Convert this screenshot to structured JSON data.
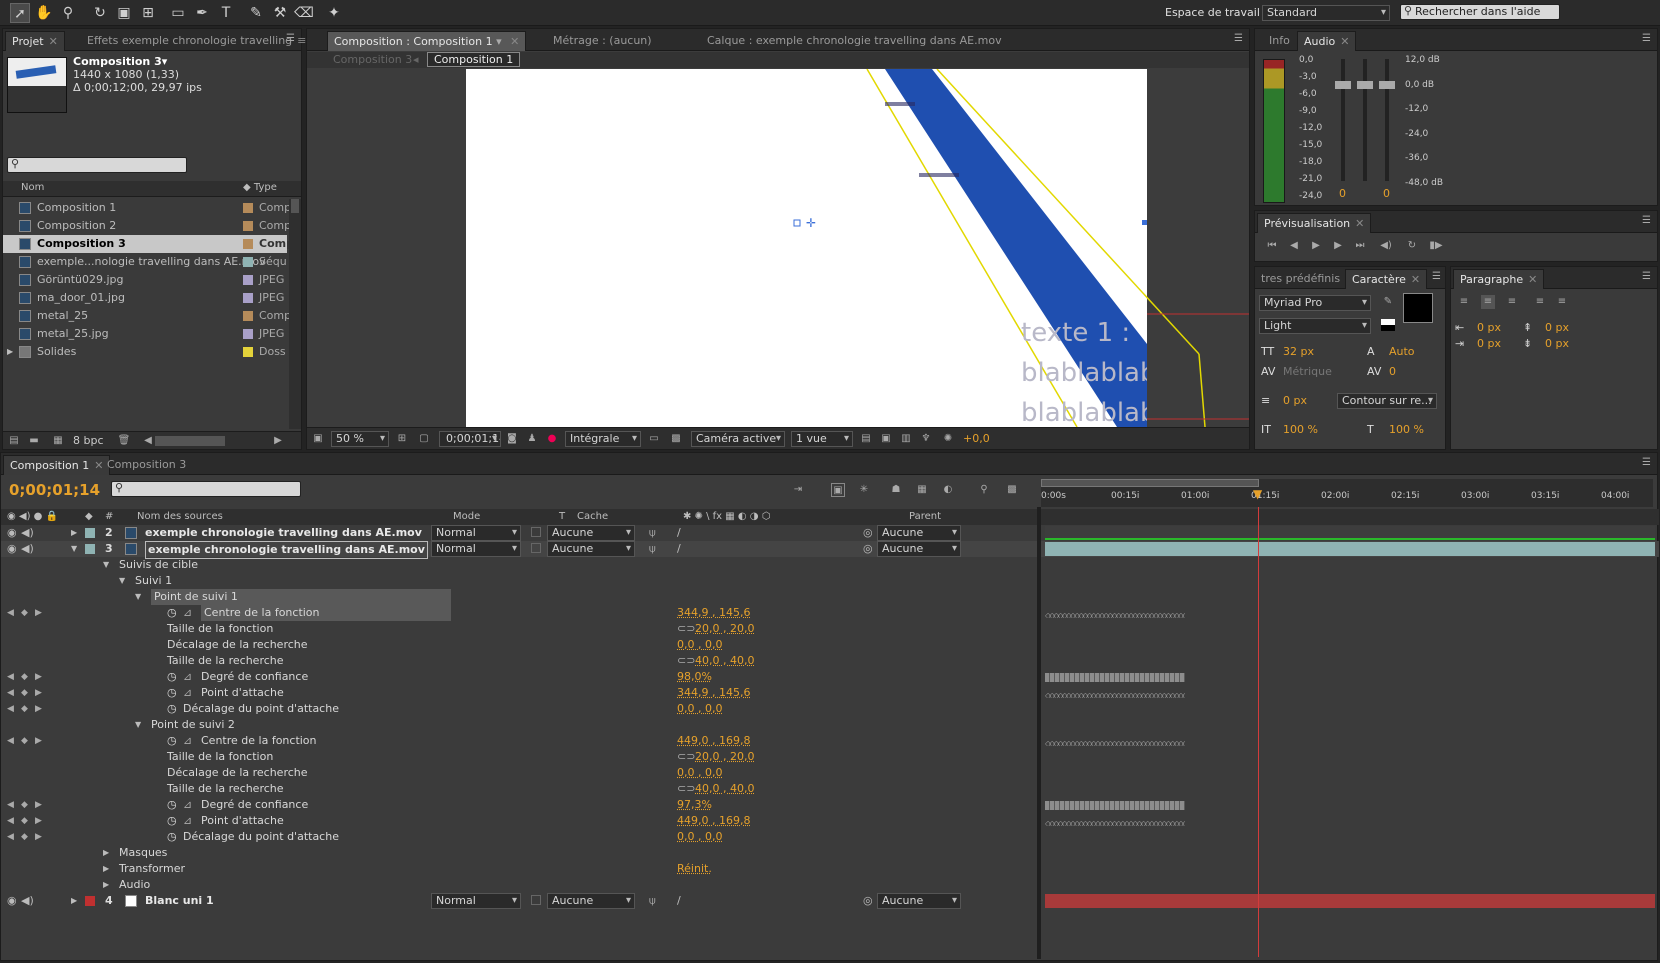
{
  "workspace": {
    "label": "Espace de travail :",
    "value": "Standard",
    "search_placeholder": "Rechercher dans l'aide"
  },
  "project": {
    "tabs": [
      "Projet",
      "Effets exemple chronologie travelling"
    ],
    "selected_name": "Composition 3▾",
    "selected_info1": "1440 x 1080 (1,33)",
    "selected_info2": "Δ 0;00;12;00, 29,97 ips",
    "col_name": "Nom",
    "col_type": "Type",
    "items": [
      {
        "name": "Composition 1",
        "type": "Comp",
        "swatch": "#b58b5a"
      },
      {
        "name": "Composition 2",
        "type": "Comp",
        "swatch": "#b58b5a"
      },
      {
        "name": "Composition 3",
        "type": "Comp",
        "swatch": "#b58b5a"
      },
      {
        "name": "exemple...nologie travelling dans AE.mov",
        "type": "Séqu",
        "swatch": "#8fb3b3"
      },
      {
        "name": "Görüntü029.jpg",
        "type": "JPEG",
        "swatch": "#a9a0c8"
      },
      {
        "name": "ma_door_01.jpg",
        "type": "JPEG",
        "swatch": "#a9a0c8"
      },
      {
        "name": "metal_25",
        "type": "Comp",
        "swatch": "#b58b5a"
      },
      {
        "name": "metal_25.jpg",
        "type": "JPEG",
        "swatch": "#a9a0c8"
      },
      {
        "name": "Solides",
        "type": "Doss",
        "swatch": "#e3d23a"
      }
    ],
    "bpc": "8 bpc"
  },
  "viewer": {
    "tabs": [
      "Composition : Composition 1",
      "Métrage : (aucun)",
      "Calque : exemple chronologie travelling dans AE.mov"
    ],
    "crumbs": [
      "Composition 3",
      "Composition 1"
    ],
    "canvas_text": [
      "texte 1 :",
      "blablablab",
      "blablablab"
    ],
    "zoom": "50 %",
    "timecode": "0;00;01;14",
    "resolution": "Intégrale",
    "camera": "Caméra active",
    "views": "1 vue",
    "exposure": "+0,0"
  },
  "audio_panel": {
    "tabs": [
      "Info",
      "Audio"
    ],
    "left_scale": [
      "0,0",
      "-3,0",
      "-6,0",
      "-9,0",
      "-12,0",
      "-15,0",
      "-18,0",
      "-21,0",
      "-24,0"
    ],
    "right_scale": [
      "12,0 dB",
      "0,0 dB",
      "-12,0",
      "-24,0",
      "-36,0",
      "-48,0 dB"
    ],
    "slider_values": [
      "0",
      "0"
    ]
  },
  "preview": {
    "tab": "Prévisualisation"
  },
  "character": {
    "tabs": [
      "tres prédéfinis",
      "Caractère"
    ],
    "font": "Myriad Pro",
    "style": "Light",
    "size": "32 px",
    "leading": "Auto",
    "kerning": "Métrique",
    "tracking": "0",
    "stroke": "0 px",
    "stroke_mode": "Contour sur re...",
    "vscale": "100 %",
    "hscale": "100 %"
  },
  "paragraph": {
    "tab": "Paragraphe",
    "values": [
      "0 px",
      "0 px",
      "0 px",
      "0 px"
    ]
  },
  "timeline": {
    "tabs": [
      "Composition 1",
      "Composition 3"
    ],
    "timecode": "0;00;01;14",
    "headers": {
      "num": "#",
      "name": "Nom des sources",
      "mode": "Mode",
      "t": "T",
      "cache": "Cache",
      "parent": "Parent"
    },
    "ruler": [
      "0:00s",
      "00:15i",
      "01:00i",
      "01:15i",
      "02:00i",
      "02:15i",
      "03:00i",
      "03:15i",
      "04:00i"
    ],
    "layers": [
      {
        "num": "2",
        "name": "exemple chronologie travelling dans AE.mov",
        "mode": "Normal",
        "cache": "Aucune",
        "parent": "Aucune"
      },
      {
        "num": "3",
        "name": "exemple chronologie travelling dans AE.mov",
        "mode": "Normal",
        "cache": "Aucune",
        "parent": "Aucune"
      },
      {
        "num": "4",
        "name": "Blanc uni 1",
        "mode": "Normal",
        "cache": "Aucune",
        "parent": "Aucune"
      }
    ],
    "props": [
      {
        "label": "Suivis de cible",
        "indent": 1,
        "twirl": "open"
      },
      {
        "label": "Suivi 1",
        "indent": 2,
        "twirl": "open"
      },
      {
        "label": "Point de suivi 1",
        "indent": 3,
        "twirl": "open",
        "hl": true
      },
      {
        "label": "Centre de la fonction",
        "indent": 4,
        "stopwatch": true,
        "graph": true,
        "value": "344,9 , 145,6",
        "hl": true,
        "kf": "kf"
      },
      {
        "label": "Taille de la fonction",
        "indent": 4,
        "link": true,
        "value": "20,0 , 20,0"
      },
      {
        "label": "Décalage de la recherche",
        "indent": 4,
        "value": "0,0 , 0,0"
      },
      {
        "label": "Taille de la recherche",
        "indent": 4,
        "link": true,
        "value": "40,0 , 40,0"
      },
      {
        "label": "Degré de confiance",
        "indent": 4,
        "stopwatch": true,
        "graph": true,
        "value": "98,0%",
        "kf": "bar"
      },
      {
        "label": "Point d'attache",
        "indent": 4,
        "stopwatch": true,
        "graph": true,
        "value": "344,9 , 145,6",
        "kf": "kf"
      },
      {
        "label": "Décalage du point d'attache",
        "indent": 4,
        "stopwatch": true,
        "value": "0,0 , 0,0"
      },
      {
        "label": "Point de suivi 2",
        "indent": 3,
        "twirl": "open"
      },
      {
        "label": "Centre de la fonction",
        "indent": 4,
        "stopwatch": true,
        "graph": true,
        "value": "449,0 , 169,8",
        "kf": "kf"
      },
      {
        "label": "Taille de la fonction",
        "indent": 4,
        "link": true,
        "value": "20,0 , 20,0"
      },
      {
        "label": "Décalage de la recherche",
        "indent": 4,
        "value": "0,0 , 0,0"
      },
      {
        "label": "Taille de la recherche",
        "indent": 4,
        "link": true,
        "value": "40,0 , 40,0"
      },
      {
        "label": "Degré de confiance",
        "indent": 4,
        "stopwatch": true,
        "graph": true,
        "value": "97,3%",
        "kf": "bar"
      },
      {
        "label": "Point d'attache",
        "indent": 4,
        "stopwatch": true,
        "graph": true,
        "value": "449,0 , 169,8",
        "kf": "kf"
      },
      {
        "label": "Décalage du point d'attache",
        "indent": 4,
        "stopwatch": true,
        "value": "0,0 , 0,0"
      },
      {
        "label": "Masques",
        "indent": 1,
        "twirl": "closed"
      },
      {
        "label": "Transformer",
        "indent": 1,
        "twirl": "closed",
        "value": "Réinit."
      },
      {
        "label": "Audio",
        "indent": 1,
        "twirl": "closed"
      }
    ]
  },
  "colors": {
    "accent": "#e6a12b",
    "selection": "#b8b8b8",
    "playhead": "#d23c3c",
    "layer_bar": "#8fb3b3",
    "solid_bar": "#a83a3a"
  }
}
